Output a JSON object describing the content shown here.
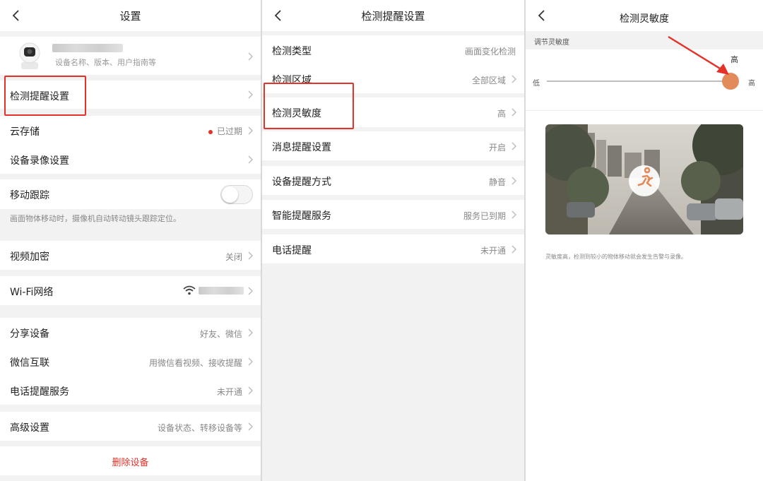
{
  "accent_red": "#e4322b",
  "accent_orange": "#e38a5a",
  "screen1": {
    "title": "设置",
    "device_subtitle": "设备名称、版本、用户指南等",
    "items": {
      "detection_settings": "检测提醒设置",
      "cloud_storage": "云存储",
      "cloud_storage_value": "已过期",
      "recording": "设备录像设置",
      "motion_tracking": "移动跟踪",
      "motion_tracking_note": "画面物体移动时，摄像机自动转动镜头跟踪定位。",
      "video_encryption": "视频加密",
      "video_encryption_value": "关闭",
      "wifi": "Wi-Fi网络",
      "share": "分享设备",
      "share_value": "好友、微信",
      "wechat": "微信互联",
      "wechat_value": "用微信看视频、接收提醒",
      "phone_service": "电话提醒服务",
      "phone_service_value": "未开通",
      "advanced": "高级设置",
      "advanced_value": "设备状态、转移设备等",
      "delete": "删除设备"
    }
  },
  "screen2": {
    "title": "检测提醒设置",
    "items": {
      "type": "检测类型",
      "type_value": "画面变化检测",
      "area": "检测区域",
      "area_value": "全部区域",
      "sensitivity": "检测灵敏度",
      "sensitivity_value": "高",
      "message": "消息提醒设置",
      "message_value": "开启",
      "method": "设备提醒方式",
      "method_value": "静音",
      "smart": "智能提醒服务",
      "smart_value": "服务已到期",
      "phone": "电话提醒",
      "phone_value": "未开通"
    }
  },
  "screen3": {
    "title": "检测灵敏度",
    "section_label": "调节灵敏度",
    "slider_low": "低",
    "slider_high": "高",
    "slider_current": "高",
    "slider_level": 1.0,
    "description": "灵敏度高，检测到较小的物体移动就会发生告警与录像。"
  }
}
